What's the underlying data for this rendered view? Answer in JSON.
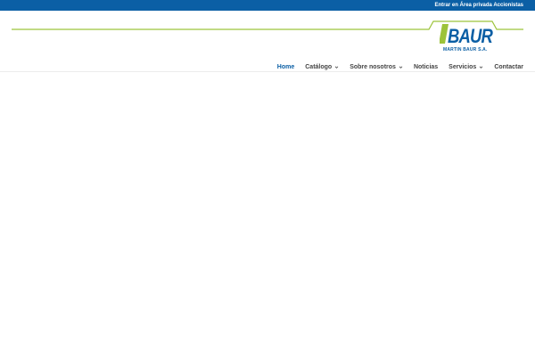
{
  "colors": {
    "brand_blue": "#0b5fa5",
    "accent_green": "#9cc33a"
  },
  "topbar": {
    "link_label": "Entrar en Área privada Accionistas"
  },
  "logo": {
    "name": "BAUR",
    "company": "MARTIN BAUR S.A."
  },
  "nav": {
    "items": [
      {
        "label": "Home",
        "active": true
      },
      {
        "label": "Catálogo",
        "has_dropdown": true,
        "icon": "chevron-down-icon"
      },
      {
        "label": "Sobre nosotros",
        "has_dropdown": true,
        "icon": "chevron-down-icon"
      },
      {
        "label": "Noticias"
      },
      {
        "label": "Servicios",
        "has_dropdown": true,
        "icon": "chevron-down-icon"
      },
      {
        "label": "Contactar"
      }
    ]
  }
}
